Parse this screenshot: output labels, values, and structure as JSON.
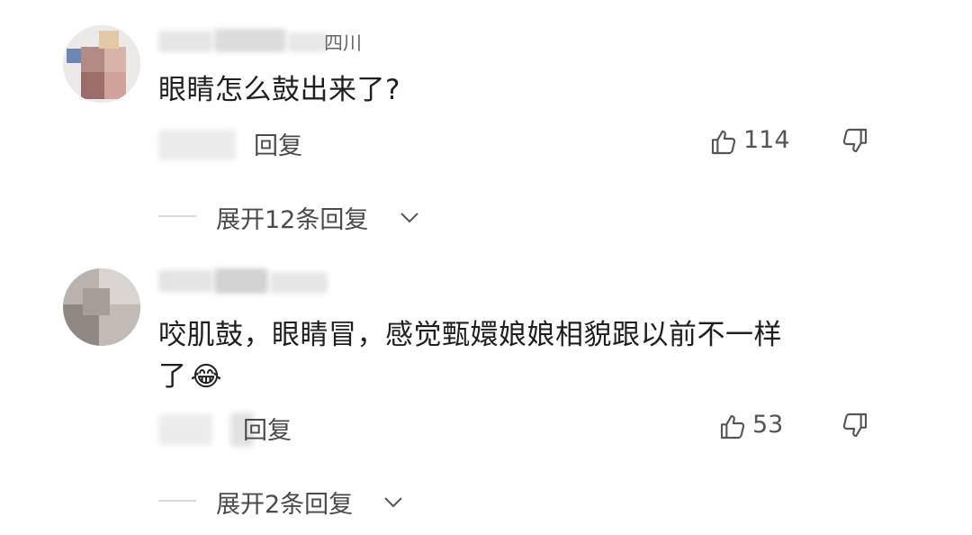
{
  "comments": [
    {
      "username_suffix": "四川",
      "text": "眼睛怎么鼓出来了?",
      "reply_label": "回复",
      "likes": "114",
      "expand_label": "展开12条回复"
    },
    {
      "username_suffix": "",
      "text_line1": "咬肌鼓，眼睛冒，感觉甄嬛娘娘相貌跟以前不一样",
      "text_line2": "了",
      "emoji": "😂",
      "reply_label": "回复",
      "likes": "53",
      "expand_label": "展开2条回复"
    }
  ],
  "icons": {
    "like": "thumbs-up-icon",
    "dislike": "thumbs-down-icon",
    "expand": "chevron-down-icon"
  },
  "colors": {
    "text": "#1f1f1f",
    "secondary": "#4a4a4a",
    "divider": "#d8d8d8"
  }
}
